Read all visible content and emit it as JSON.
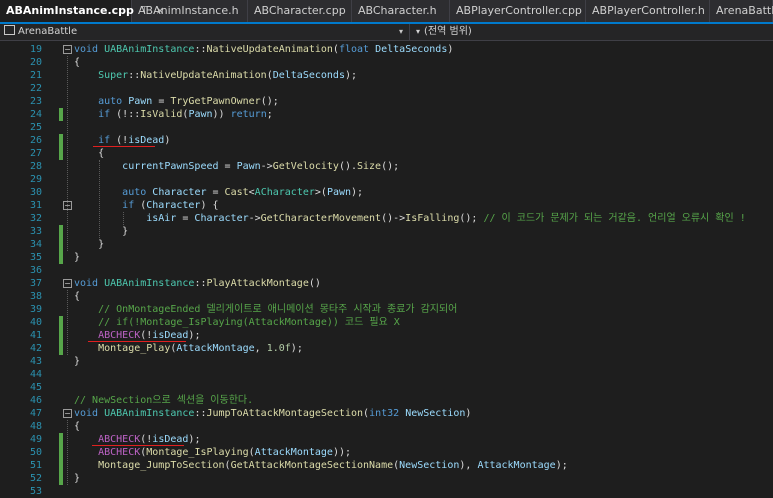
{
  "tabs": [
    {
      "label": "ABAnimInstance.cpp",
      "active": true,
      "pinned": true
    },
    {
      "label": "ABAnimInstance.h"
    },
    {
      "label": "ABCharacter.cpp"
    },
    {
      "label": "ABCharacter.h"
    },
    {
      "label": "ABPlayerController.cpp"
    },
    {
      "label": "ABPlayerController.h"
    },
    {
      "label": "ArenaBattle.c"
    }
  ],
  "tab_close_glyph": "×",
  "tab_pin_glyph": "⊤",
  "navbar": {
    "project": "ArenaBattle",
    "scope": "(전역 범위)",
    "dropdown_glyph": "▾"
  },
  "fold_glyph_open": "−",
  "lines": [
    {
      "n": "19",
      "text": "void UABAnimInstance::NativeUpdateAnimation(float DeltaSeconds)"
    },
    {
      "n": "20",
      "text": "{"
    },
    {
      "n": "21",
      "text": "    Super::NativeUpdateAnimation(DeltaSeconds);"
    },
    {
      "n": "22",
      "text": ""
    },
    {
      "n": "23",
      "text": "    auto Pawn = TryGetPawnOwner();"
    },
    {
      "n": "24",
      "text": "    if (!::IsValid(Pawn)) return;"
    },
    {
      "n": "25",
      "text": ""
    },
    {
      "n": "26",
      "text": "    if (!isDead)"
    },
    {
      "n": "27",
      "text": "    {"
    },
    {
      "n": "28",
      "text": "        currentPawnSpeed = Pawn->GetVelocity().Size();"
    },
    {
      "n": "29",
      "text": ""
    },
    {
      "n": "30",
      "text": "        auto Character = Cast<ACharacter>(Pawn);"
    },
    {
      "n": "31",
      "text": "        if (Character) {"
    },
    {
      "n": "32",
      "text": "            isAir = Character->GetCharacterMovement()->IsFalling(); // 이 코드가 문제가 되는 거같음. 언리얼 오류시 확인 !"
    },
    {
      "n": "33",
      "text": "        }"
    },
    {
      "n": "34",
      "text": "    }"
    },
    {
      "n": "35",
      "text": "}"
    },
    {
      "n": "36",
      "text": ""
    },
    {
      "n": "37",
      "text": "void UABAnimInstance::PlayAttackMontage()"
    },
    {
      "n": "38",
      "text": "{"
    },
    {
      "n": "39",
      "text": "    // OnMontageEnded 델리게이트로 애니메이션 몽타주 시작과 종료가 감지되어"
    },
    {
      "n": "40",
      "text": "    // if(!Montage_IsPlaying(AttackMontage)) 코드 필요 X"
    },
    {
      "n": "41",
      "text": "    ABCHECK(!isDead);"
    },
    {
      "n": "42",
      "text": "    Montage_Play(AttackMontage, 1.0f);"
    },
    {
      "n": "43",
      "text": "}"
    },
    {
      "n": "44",
      "text": ""
    },
    {
      "n": "45",
      "text": ""
    },
    {
      "n": "46",
      "text": "// NewSection으로 섹션을 이동한다."
    },
    {
      "n": "47",
      "text": "void UABAnimInstance::JumpToAttackMontageSection(int32 NewSection)"
    },
    {
      "n": "48",
      "text": "{"
    },
    {
      "n": "49",
      "text": "    ABCHECK(!isDead);"
    },
    {
      "n": "50",
      "text": "    ABCHECK(Montage_IsPlaying(AttackMontage));"
    },
    {
      "n": "51",
      "text": "    Montage_JumpToSection(GetAttackMontageSectionName(NewSection), AttackMontage);"
    },
    {
      "n": "52",
      "text": "}"
    },
    {
      "n": "53",
      "text": ""
    }
  ],
  "colors": {
    "background": "#1e1e1e",
    "accent": "#007acc",
    "keyword": "#569cd6",
    "function": "#dcdcaa",
    "comment": "#57a64a",
    "type": "#4ec9b0",
    "macro": "#bd63c5",
    "line_number": "#2b91af",
    "change_bar": "#57a64a",
    "annotation_underline": "#e02020"
  }
}
